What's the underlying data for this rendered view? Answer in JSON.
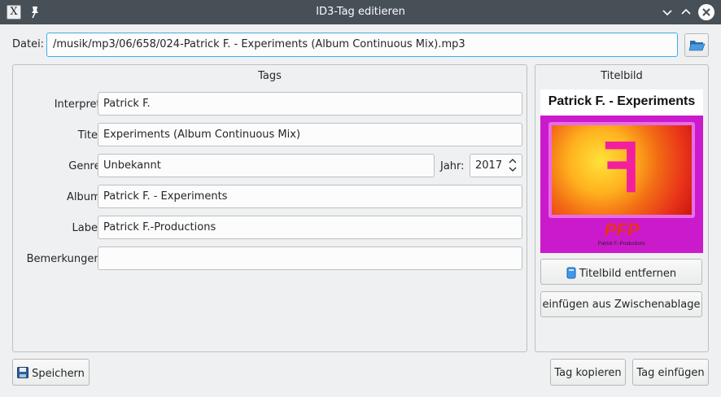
{
  "window": {
    "title": "ID3-Tag editieren"
  },
  "file": {
    "label": "Datei:",
    "path": "/musik/mp3/06/658/024-Patrick F. - Experiments (Album Continuous Mix).mp3"
  },
  "tags": {
    "group_title": "Tags",
    "artist_label": "Interpret:",
    "artist": "Patrick F.",
    "title_label": "Titel:",
    "title": "Experiments (Album Continuous Mix)",
    "genre_label": "Genre:",
    "genre": "Unbekannt",
    "year_label": "Jahr:",
    "year": "2017",
    "album_label": "Album:",
    "album": "Patrick F. - Experiments",
    "label_label": "Label:",
    "label": "Patrick F.-Productions",
    "comment_label": "Bemerkungen:",
    "comment": ""
  },
  "cover": {
    "group_title": "Titelbild",
    "image_heading": "Patrick F. - Experiments",
    "image_letter": "ꟻ",
    "image_logo": "PFP",
    "image_caption": "Patrick F.-Productions",
    "remove_label": "Titelbild entfernen",
    "paste_label": "einfügen aus Zwischenablage"
  },
  "footer": {
    "save_label": "Speichern",
    "copy_tag_label": "Tag kopieren",
    "paste_tag_label": "Tag einfügen"
  },
  "colors": {
    "titlebar": "#475057",
    "focus_border": "#3daee9",
    "cover_magenta": "#cb1acb"
  }
}
